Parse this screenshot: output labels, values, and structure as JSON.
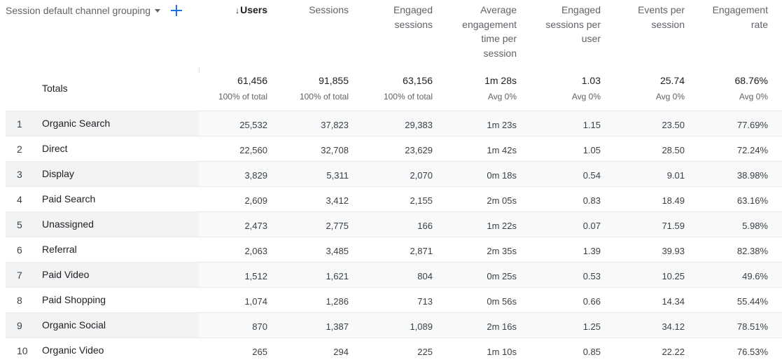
{
  "dimension": {
    "label": "Session default channel grouping",
    "add_icon": "plus-icon",
    "accent": "#1a73e8"
  },
  "columns": [
    {
      "id": "users",
      "label": "Users",
      "sort_arrow": "↓",
      "sorted": true
    },
    {
      "id": "sessions",
      "label": "Sessions"
    },
    {
      "id": "engaged_sessions",
      "label": "Engaged\nsessions"
    },
    {
      "id": "avg_engagement_time",
      "label": "Average\nengagement\ntime per\nsession"
    },
    {
      "id": "engaged_sessions_per_user",
      "label": "Engaged\nsessions per\nuser"
    },
    {
      "id": "events_per_session",
      "label": "Events per\nsession"
    },
    {
      "id": "engagement_rate",
      "label": "Engagement\nrate"
    }
  ],
  "totals": {
    "label": "Totals",
    "values": [
      "61,456",
      "91,855",
      "63,156",
      "1m 28s",
      "1.03",
      "25.74",
      "68.76%"
    ],
    "subs": [
      "100% of total",
      "100% of total",
      "100% of total",
      "Avg 0%",
      "Avg 0%",
      "Avg 0%",
      "Avg 0%"
    ]
  },
  "rows": [
    {
      "index": "1",
      "channel": "Organic Search",
      "values": [
        "25,532",
        "37,823",
        "29,383",
        "1m 23s",
        "1.15",
        "23.50",
        "77.69%"
      ]
    },
    {
      "index": "2",
      "channel": "Direct",
      "values": [
        "22,560",
        "32,708",
        "23,629",
        "1m 42s",
        "1.05",
        "28.50",
        "72.24%"
      ]
    },
    {
      "index": "3",
      "channel": "Display",
      "values": [
        "3,829",
        "5,311",
        "2,070",
        "0m 18s",
        "0.54",
        "9.01",
        "38.98%"
      ]
    },
    {
      "index": "4",
      "channel": "Paid Search",
      "values": [
        "2,609",
        "3,412",
        "2,155",
        "2m 05s",
        "0.83",
        "18.49",
        "63.16%"
      ]
    },
    {
      "index": "5",
      "channel": "Unassigned",
      "values": [
        "2,473",
        "2,775",
        "166",
        "1m 22s",
        "0.07",
        "71.59",
        "5.98%"
      ]
    },
    {
      "index": "6",
      "channel": "Referral",
      "values": [
        "2,063",
        "3,485",
        "2,871",
        "2m 35s",
        "1.39",
        "39.93",
        "82.38%"
      ]
    },
    {
      "index": "7",
      "channel": "Paid Video",
      "values": [
        "1,512",
        "1,621",
        "804",
        "0m 25s",
        "0.53",
        "10.25",
        "49.6%"
      ]
    },
    {
      "index": "8",
      "channel": "Paid Shopping",
      "values": [
        "1,074",
        "1,286",
        "713",
        "0m 56s",
        "0.66",
        "14.34",
        "55.44%"
      ]
    },
    {
      "index": "9",
      "channel": "Organic Social",
      "values": [
        "870",
        "1,387",
        "1,089",
        "2m 16s",
        "1.25",
        "34.12",
        "78.51%"
      ]
    },
    {
      "index": "10",
      "channel": "Organic Video",
      "values": [
        "265",
        "294",
        "225",
        "1m 10s",
        "0.85",
        "22.22",
        "76.53%"
      ]
    }
  ]
}
